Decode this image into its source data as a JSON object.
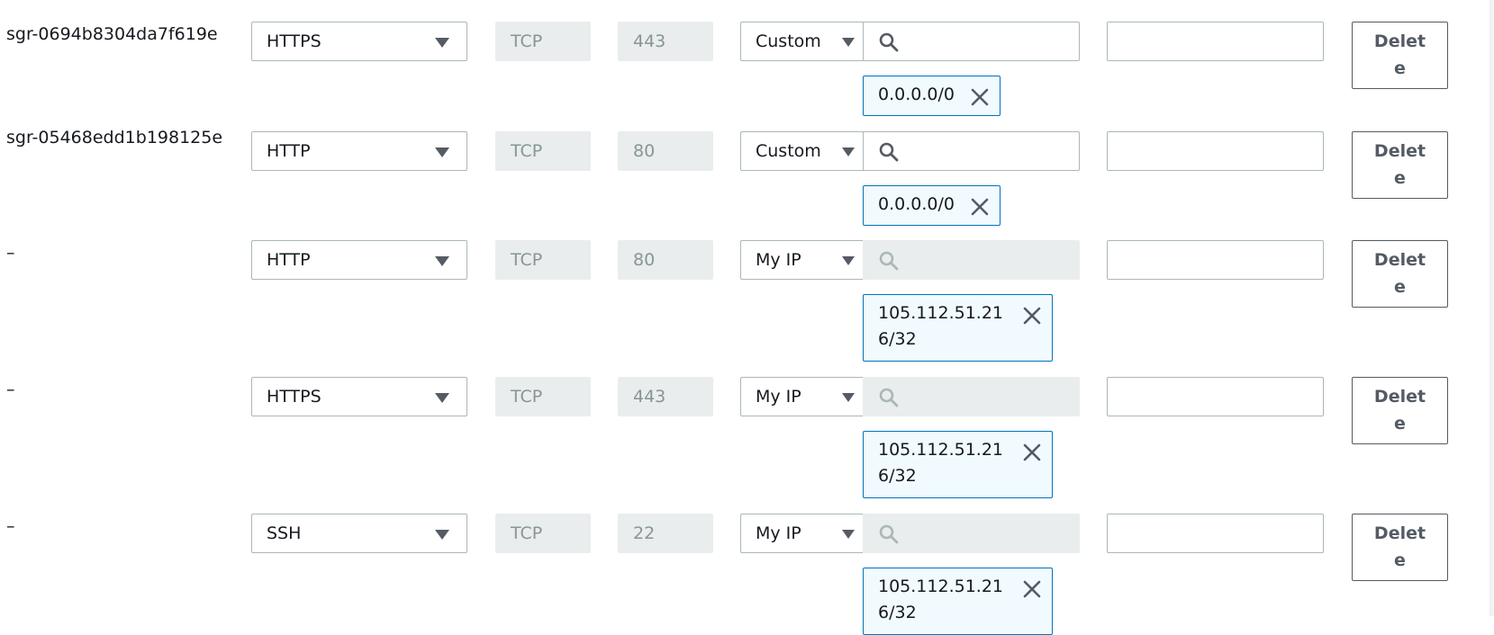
{
  "rules": [
    {
      "id": "sgr-0694b8304da7f619e",
      "type": "HTTPS",
      "protocol": "TCP",
      "port": "443",
      "source": "Custom",
      "cidr": "0.0.0.0/0",
      "delete_label": "Delete"
    },
    {
      "id": "sgr-05468edd1b198125e",
      "type": "HTTP",
      "protocol": "TCP",
      "port": "80",
      "source": "Custom",
      "cidr": "0.0.0.0/0",
      "delete_label": "Delete"
    },
    {
      "id": "–",
      "type": "HTTP",
      "protocol": "TCP",
      "port": "80",
      "source": "My IP",
      "cidr": "105.112.51.216/32",
      "delete_label": "Delete"
    },
    {
      "id": "–",
      "type": "HTTPS",
      "protocol": "TCP",
      "port": "443",
      "source": "My IP",
      "cidr": "105.112.51.216/32",
      "delete_label": "Delete"
    },
    {
      "id": "–",
      "type": "SSH",
      "protocol": "TCP",
      "port": "22",
      "source": "My IP",
      "cidr": "105.112.51.216/32",
      "delete_label": "Delete"
    }
  ],
  "icons": {
    "dropdown": "caret-down-icon",
    "search": "search-icon",
    "remove": "close-icon"
  },
  "colors": {
    "token_border": "#0073bb",
    "token_background": "#f1faff",
    "disabled_background": "#eaeded",
    "border": "#aab7b8"
  }
}
